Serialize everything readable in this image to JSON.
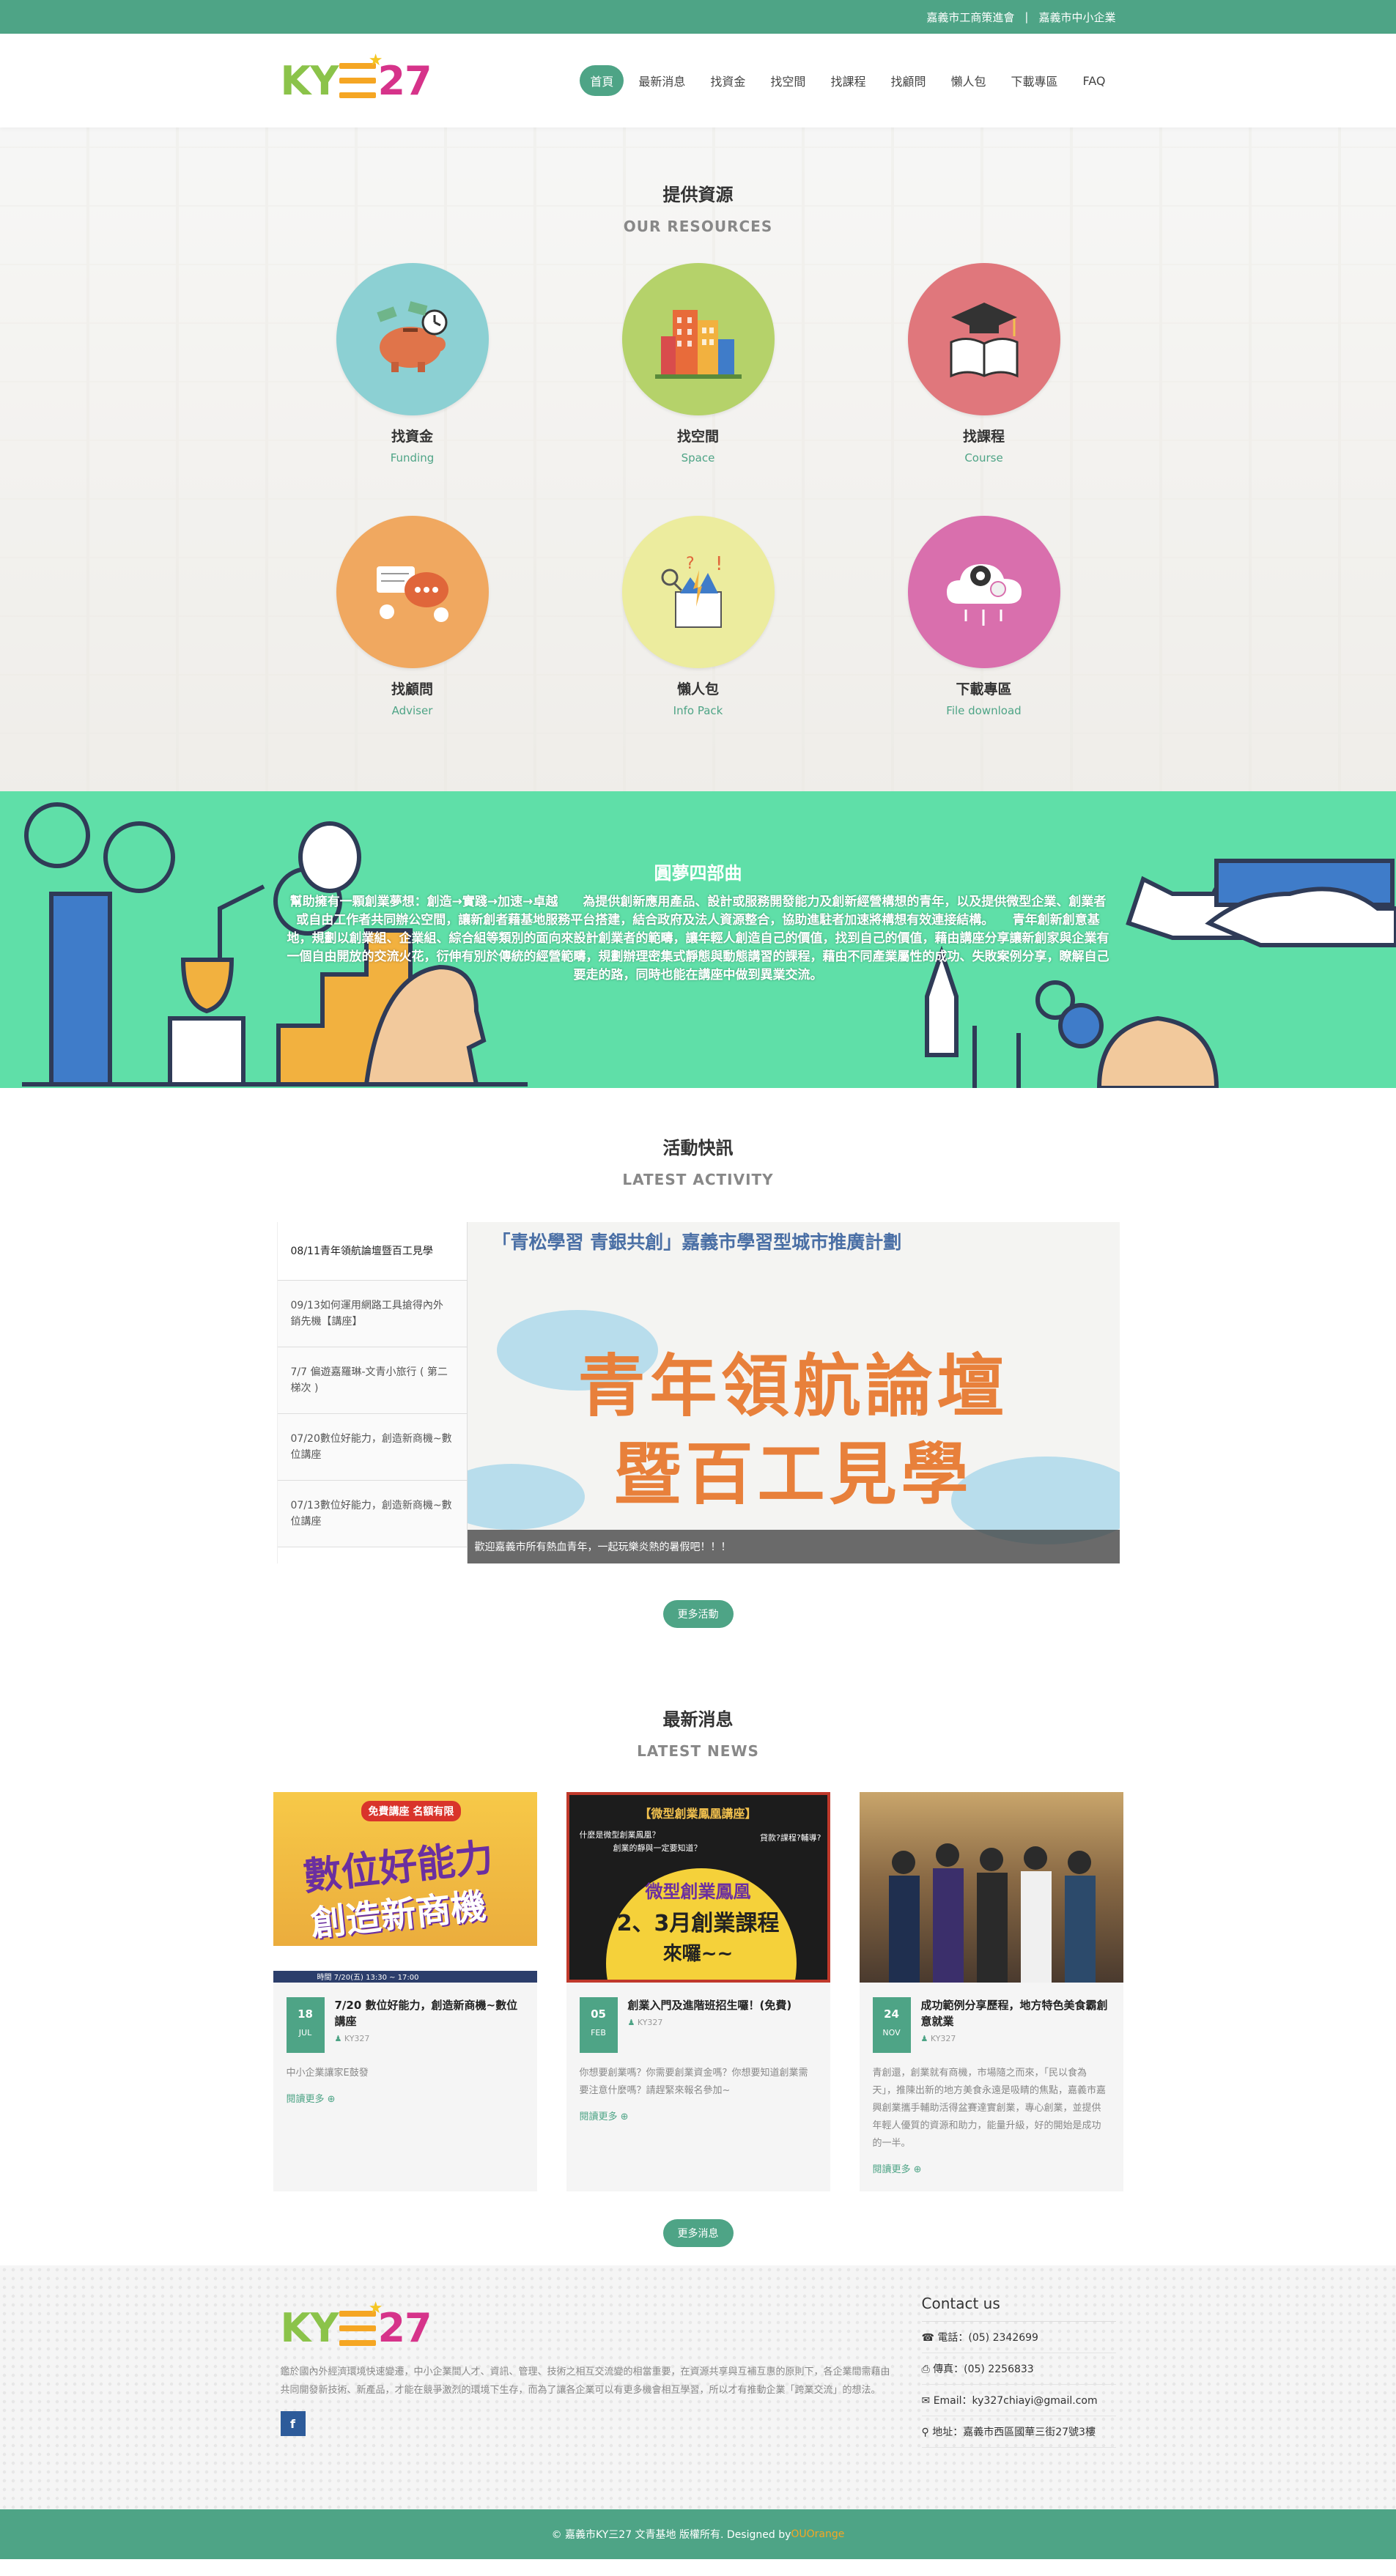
{
  "topbar": {
    "link1": "嘉義市工商策進會",
    "sep": "|",
    "link2": "嘉義市中小企業"
  },
  "logo": {
    "ky": "KY",
    "num": "27"
  },
  "nav": {
    "items": [
      "首頁",
      "最新消息",
      "找資金",
      "找空間",
      "找課程",
      "找顧問",
      "懶人包",
      "下載專區",
      "FAQ"
    ]
  },
  "resources": {
    "title": "提供資源",
    "subtitle": "OUR RESOURCES",
    "items": [
      {
        "cn": "找資金",
        "en": "Funding",
        "color": "#8cd0d3",
        "icon": "piggy-bank-icon"
      },
      {
        "cn": "找空間",
        "en": "Space",
        "color": "#b5d26a",
        "icon": "buildings-icon"
      },
      {
        "cn": "找課程",
        "en": "Course",
        "color": "#e0777c",
        "icon": "graduation-book-icon"
      },
      {
        "cn": "找顧問",
        "en": "Adviser",
        "color": "#f0a860",
        "icon": "chat-bubbles-icon"
      },
      {
        "cn": "懶人包",
        "en": "Info Pack",
        "color": "#ecec9e",
        "icon": "idea-box-icon"
      },
      {
        "cn": "下載專區",
        "en": "File download",
        "color": "#d96fad",
        "icon": "cloud-download-icon"
      }
    ]
  },
  "dream": {
    "title": "圓夢四部曲",
    "text": "幫助擁有一顆創業夢想：創造→實踐→加速→卓越　　為提供創新應用產品、設計或服務開發能力及創新經營構想的青年，以及提供微型企業、創業者或自由工作者共同辦公空間，讓新創者藉基地服務平台搭建，結合政府及法人資源整合，協助進駐者加速將構想有效連接結構。　　青年創新創意基地，規劃以創業組、企業組、綜合組等類別的面向來設計創業者的範疇，讓年輕人創造自己的價值，找到自己的價值，藉由講座分享讓新創家與企業有一個自由開放的交流火花，衍伸有別於傳統的經營範疇，規劃辦理密集式靜態與動態講習的課程，藉由不同產業屬性的成功、失敗案例分享，瞭解自己要走的路，同時也能在講座中做到異業交流。"
  },
  "activity": {
    "title": "活動快訊",
    "subtitle": "LATEST ACTIVITY",
    "list": [
      "08/11青年領航論壇暨百工見學",
      "09/13如何運用網路工具搶得內外銷先機【講座】",
      "7/7 偏遊嘉羅琳-文青小旅行 ( 第二梯次 )",
      "07/20數位好能力，創造新商機~數位講座",
      "07/13數位好能力，創造新商機~數位講座"
    ],
    "banner_top": "「青松學習 青銀共創」嘉義市學習型城市推廣計劃",
    "banner_line1": "青年領航論壇",
    "banner_line2": "暨百工見學",
    "caption": "歡迎嘉義市所有熱血青年，一起玩樂炎熱的暑假吧！！！",
    "more": "更多活動"
  },
  "news": {
    "title": "最新消息",
    "subtitle": "LATEST NEWS",
    "cards": [
      {
        "day": "18",
        "month": "JUL",
        "title": "7/20 數位好能力，創造新商機~數位講座",
        "author": "KY327",
        "excerpt": "中小企業讓家E鼓發",
        "more": "閱讀更多",
        "pic_tag": "免費講座 名額有限",
        "pic_line1": "數位好能力",
        "pic_line2": "創造新商機",
        "pic_footer": "時間 7/20(五) 13:30 ~ 17:00"
      },
      {
        "day": "05",
        "month": "FEB",
        "title": "創業入門及進階班招生囉！(免費)",
        "author": "KY327",
        "excerpt": "你想要創業嗎？你需要創業資金嗎？你想要知道創業需要注意什麼嗎？請趕緊來報名參加~",
        "more": "閱讀更多",
        "pic_tag": "【微型創業鳳凰講座】",
        "pic_q1": "什麼是微型創業鳳凰？",
        "pic_q2": "創業的靜與一定要知道？",
        "pic_q3": "貸款?課程?輔導?",
        "pic_brand": "微型創業鳳凰",
        "pic_line1": "2、3月創業課程",
        "pic_line2": "來囉~~"
      },
      {
        "day": "24",
        "month": "NOV",
        "title": "成功範例分享歷程，地方特色美食霸創意就業",
        "author": "KY327",
        "excerpt": "青創還，創業就有商機，市場隨之而來，「民以食為天」，推陳出新的地方美食永遠是吸睛的焦點，嘉義市嘉興創業攜手輔助活得盆賽達實創業，專心創業，並提供年輕人優質的資源和助力，能量升級，好的開始是成功的一半。",
        "more": "閱讀更多"
      }
    ],
    "more": "更多消息"
  },
  "footer": {
    "about": "鑑於國內外經濟環境快速變遷，中小企業間人才、資訊、管理、技術之相互交流變的相當重要，在資源共享與互補互惠的原則下，各企業間需藉由共同開發新技術、新產品，才能在競爭激烈的環境下生存，而為了讓各企業可以有更多機會相互學習，所以才有推動企業「跨業交流」的想法。",
    "facebook": "f",
    "contact_title": "Contact us",
    "phone": "電話：(05) 2342699",
    "fax": "傳真：(05) 2256833",
    "email": "Email：ky327chiayi@gmail.com",
    "address": "地址：嘉義市西區國華三街27號3樓"
  },
  "copyright": {
    "text": "© 嘉義市KY三27 文青基地 版權所有. Designed by ",
    "designer": "OUOrange"
  }
}
